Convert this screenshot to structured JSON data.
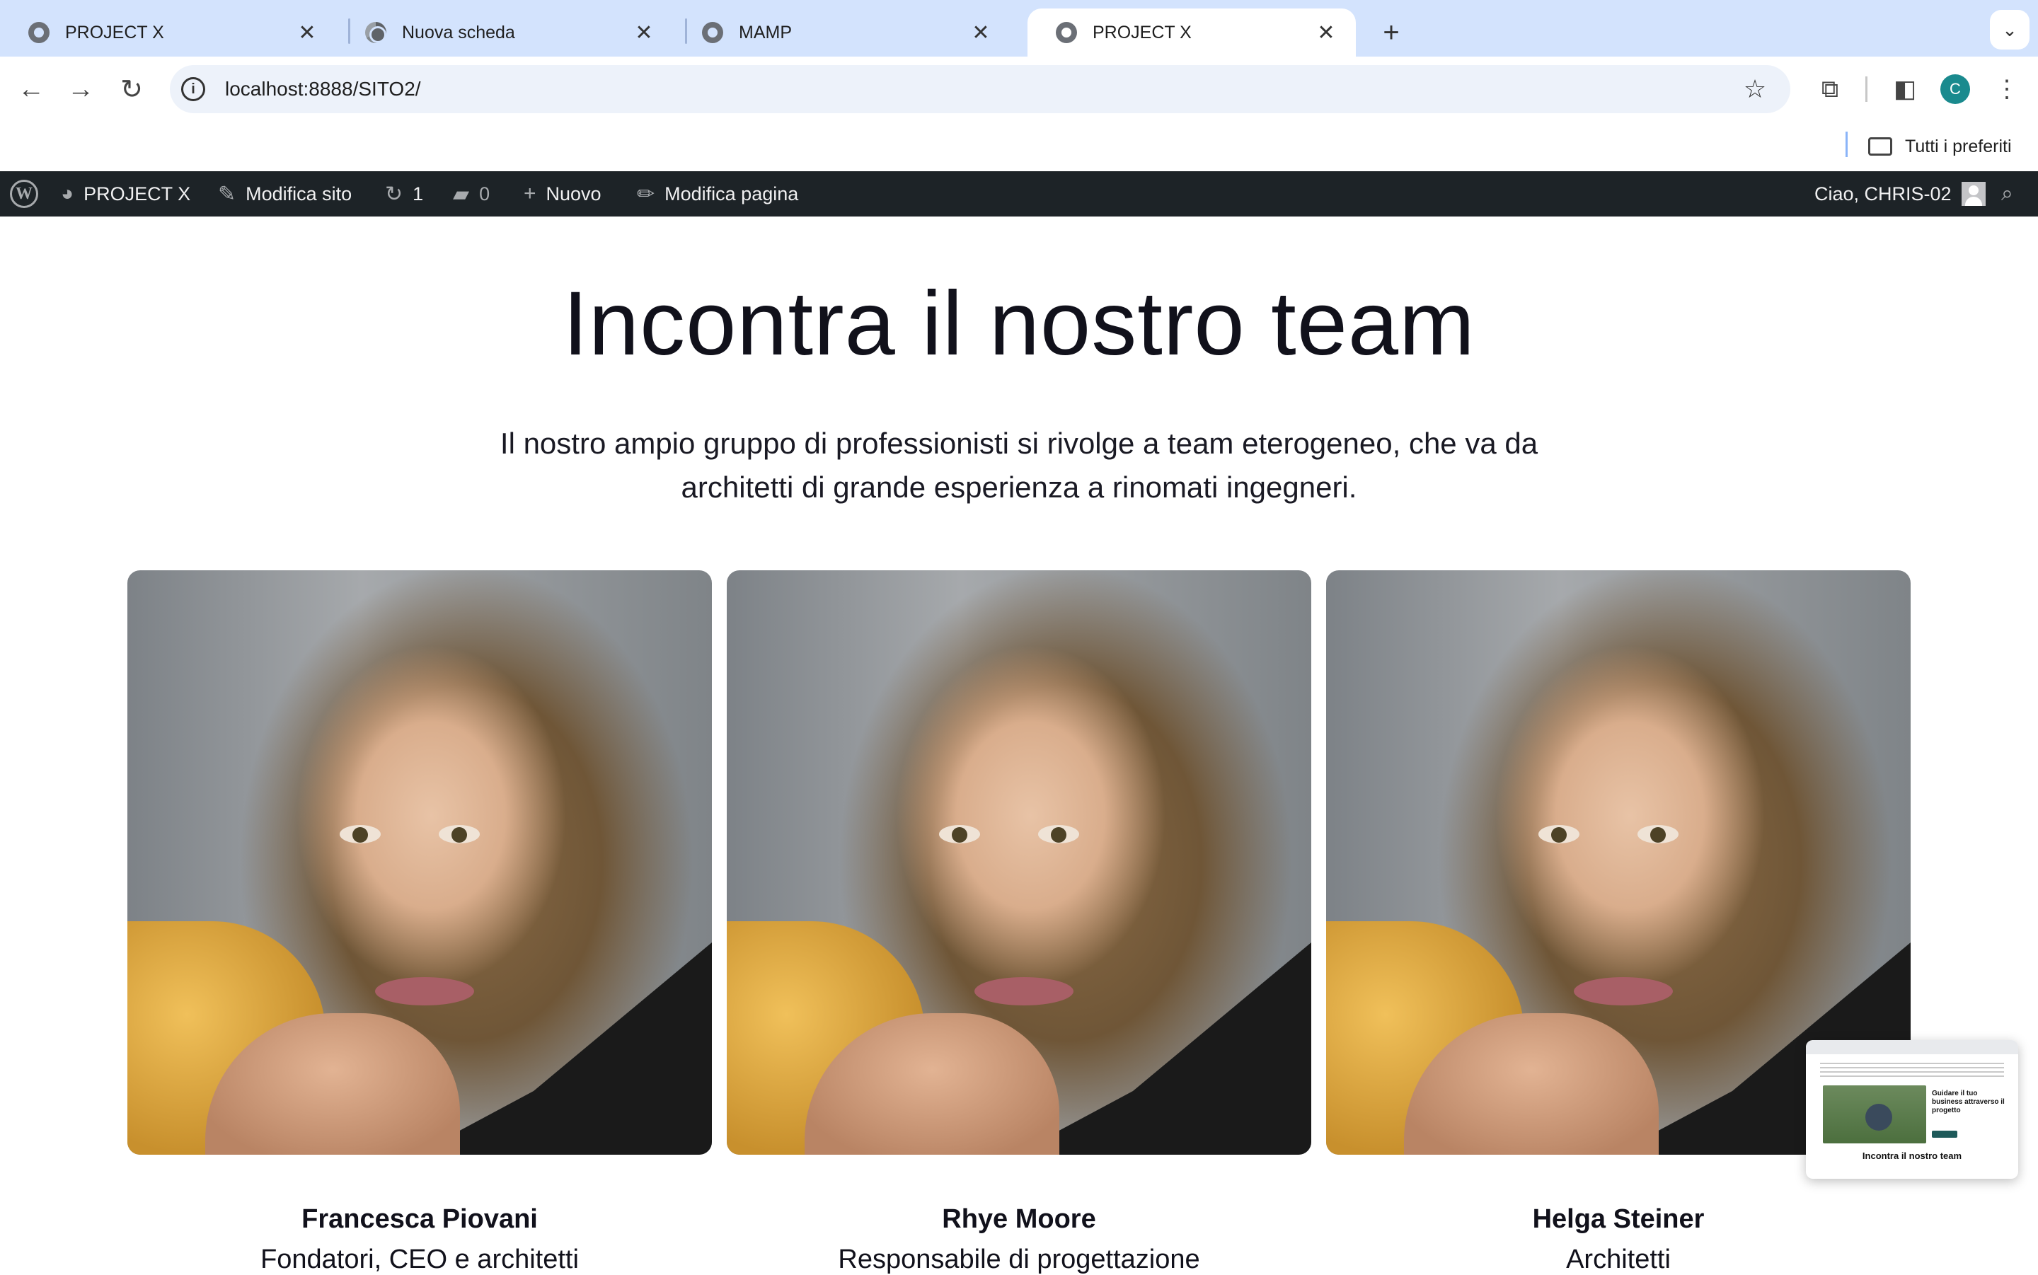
{
  "browser": {
    "tabs": [
      {
        "title": "PROJECT X",
        "active": false
      },
      {
        "title": "Nuova scheda",
        "active": false
      },
      {
        "title": "MAMP",
        "active": false
      },
      {
        "title": "PROJECT X",
        "active": true
      }
    ],
    "url": "localhost:8888/SITO2/",
    "profile_initial": "C",
    "bookmarks_all_label": "Tutti i preferiti"
  },
  "adminbar": {
    "site_name": "PROJECT X",
    "edit_site": "Modifica sito",
    "updates_count": "1",
    "comments_count": "0",
    "new_label": "Nuovo",
    "edit_page": "Modifica pagina",
    "greeting": "Ciao, CHRIS-02"
  },
  "page": {
    "heading": "Incontra il nostro team",
    "lead": "Il nostro ampio gruppo di professionisti si rivolge a team eterogeneo, che va da architetti di grande esperienza a rinomati ingegneri.",
    "team": [
      {
        "name": "Francesca Piovani",
        "role": "Fondatori, CEO e architetti"
      },
      {
        "name": "Rhye Moore",
        "role": "Responsabile di progettazione"
      },
      {
        "name": "Helga Steiner",
        "role": "Architetti"
      }
    ]
  },
  "tab_preview": {
    "title_text": "Guidare il tuo business attraverso il progetto",
    "heading": "Incontra il nostro team"
  }
}
